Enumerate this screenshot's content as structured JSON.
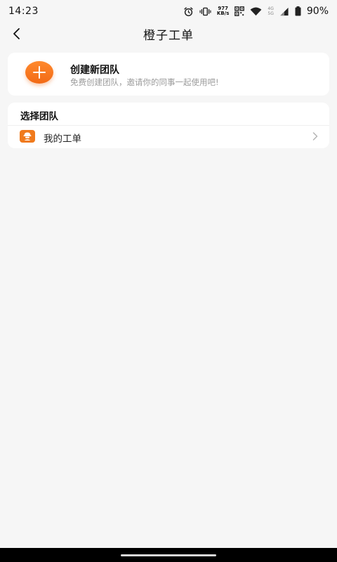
{
  "status_bar": {
    "time": "14:23",
    "net_speed_value": "977",
    "net_speed_unit": "KB/s",
    "net_gen_top": "4G",
    "net_gen_bottom": "5G",
    "battery": "90%",
    "icons": [
      "alarm-icon",
      "vibrate-icon",
      "qr-icon",
      "wifi-icon",
      "signal-icon",
      "battery-icon"
    ]
  },
  "header": {
    "title": "橙子工单",
    "back_icon": "chevron-left-icon"
  },
  "create_team": {
    "title": "创建新团队",
    "subtitle": "免费创建团队，邀请你的同事一起使用吧!",
    "icon": "plus-icon",
    "accent": "#f26a15"
  },
  "select_team": {
    "title": "选择团队",
    "items": [
      {
        "label": "我的工单",
        "icon": "worker-icon",
        "arrow": "chevron-right-icon"
      }
    ]
  },
  "colors": {
    "background": "#f6f6f6",
    "card": "#ffffff",
    "accent": "#f07a1c"
  }
}
